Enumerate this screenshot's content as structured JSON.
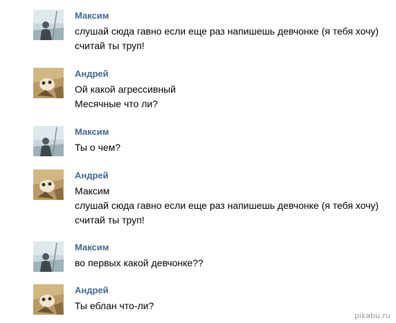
{
  "messages": [
    {
      "author": "Максим",
      "avatar": "maksim-avatar",
      "lines": [
        "слушай сюда гавно если еще раз напишешь девчонке (я тебя хочу)",
        "считай ты труп!"
      ]
    },
    {
      "author": "Андрей",
      "avatar": "andrey-avatar",
      "lines": [
        "Ой какой агрессивный",
        "Месячные что ли?"
      ]
    },
    {
      "author": "Максим",
      "avatar": "maksim-avatar",
      "lines": [
        "Ты о чем?"
      ]
    },
    {
      "author": "Андрей",
      "avatar": "andrey-avatar",
      "lines": [
        "Максим",
        "слушай сюда гавно если еще раз напишешь девчонке (я тебя хочу)",
        "считай ты труп!"
      ]
    },
    {
      "author": "Максим",
      "avatar": "maksim-avatar",
      "lines": [
        "во первых какой девчонке??"
      ]
    },
    {
      "author": "Андрей",
      "avatar": "andrey-avatar",
      "lines": [
        "Ты еблан что-ли?"
      ]
    }
  ],
  "watermark": "pikabu.ru",
  "colors": {
    "author_name": "#45688e",
    "message_text": "#000000",
    "background": "#ffffff"
  }
}
